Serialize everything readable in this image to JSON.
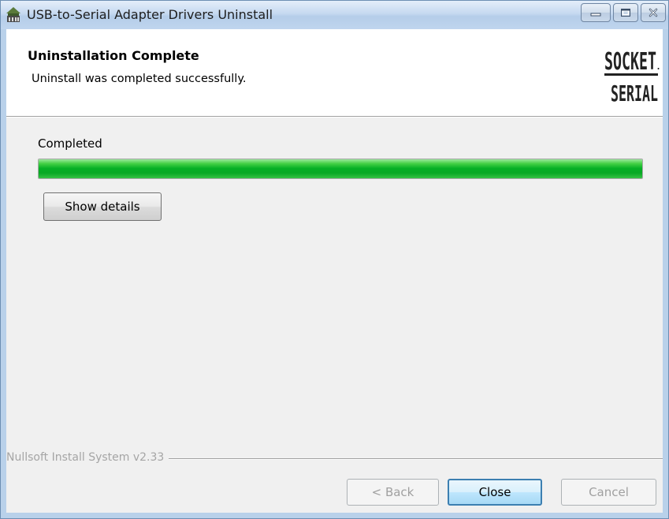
{
  "window": {
    "title": "USB-to-Serial Adapter Drivers Uninstall",
    "icon": "uninstall-app-icon"
  },
  "header": {
    "title": "Uninstallation Complete",
    "subtitle": "Uninstall was completed successfully.",
    "logo": {
      "line1": "SOCKET",
      "line2": "SERIAL",
      "mark": "."
    }
  },
  "body": {
    "status_text": "Completed",
    "progress_percent": 100,
    "show_details_label": "Show details"
  },
  "footer": {
    "branding": "Nullsoft Install System v2.33",
    "back_label": "< Back",
    "close_label": "Close",
    "cancel_label": "Cancel"
  },
  "colors": {
    "progress_green": "#06b025",
    "titlebar": "#c6d9f0",
    "body_bg": "#f0f0f0",
    "close_focus_border": "#3c7fb1"
  }
}
